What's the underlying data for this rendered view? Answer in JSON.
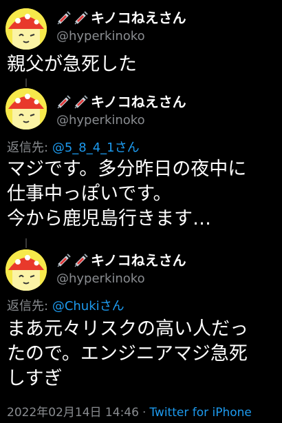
{
  "tweets": [
    {
      "author": {
        "name": "キノコねえさん",
        "handle": "@hyperkinoko",
        "avatar_icon": "mushroom-avatar",
        "name_icons": [
          "syringe-icon",
          "syringe-icon"
        ]
      },
      "lines": [
        "親父が急死した"
      ]
    },
    {
      "author": {
        "name": "キノコねえさん",
        "handle": "@hyperkinoko",
        "avatar_icon": "mushroom-avatar",
        "name_icons": [
          "syringe-icon",
          "syringe-icon"
        ]
      },
      "reply_label": "返信先:",
      "reply_to": "@5_8_4_1さん",
      "lines": [
        "マジです。多分昨日の夜中に",
        "仕事中っぽいです。",
        "今から鹿児島行きます…"
      ]
    },
    {
      "author": {
        "name": "キノコねえさん",
        "handle": "@hyperkinoko",
        "avatar_icon": "mushroom-avatar",
        "name_icons": [
          "syringe-icon",
          "syringe-icon"
        ]
      },
      "reply_label": "返信先:",
      "reply_to": "@Chukiさん",
      "lines": [
        "まあ元々リスクの高い人だっ",
        "たので。エンジニアマジ急死",
        "しすぎ"
      ],
      "timestamp": "2022年02月14日 14:46",
      "separator": "·",
      "client": "Twitter for iPhone"
    }
  ],
  "colors": {
    "background": "#000000",
    "text": "#ffffff",
    "muted": "#8a8d91",
    "link": "#1d9bf0",
    "avatar_bg": "#f6e94b",
    "mushroom_cap": "#e8392b"
  }
}
